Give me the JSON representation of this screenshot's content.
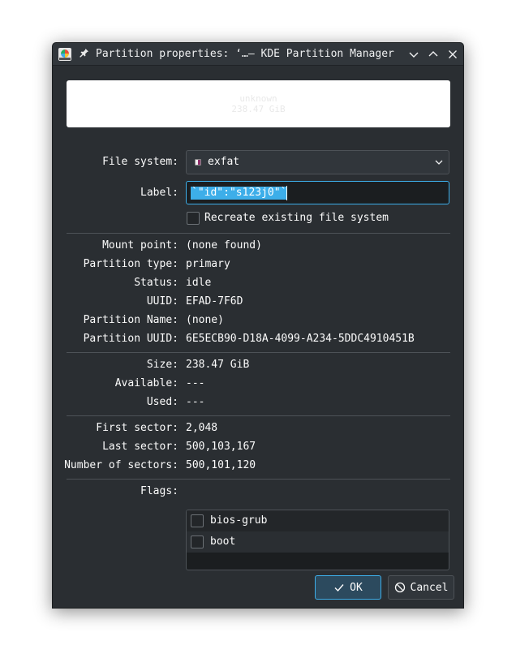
{
  "window": {
    "title": "Partition properties: ‘…— KDE Partition Manager"
  },
  "icons": {
    "app": "kde-partition-manager-icon",
    "pin": "pin-icon",
    "minimize": "chevron-down-icon",
    "maximize": "chevron-up-icon",
    "close": "close-icon",
    "dropdown": "chevron-down-icon",
    "ok": "checkmark-icon",
    "cancel": "cancel-icon"
  },
  "preview": {
    "line1": "unknown",
    "line2": "238.47 GiB"
  },
  "form": {
    "file_system_label": "File system:",
    "file_system_value": "exfat",
    "label_label": "Label:",
    "label_value": "`\"id\":\"s123j0\"`",
    "recreate_label": "Recreate existing file system",
    "recreate_checked": false
  },
  "info": {
    "mount_point_label": "Mount point:",
    "mount_point_value": "(none found)",
    "partition_type_label": "Partition type:",
    "partition_type_value": "primary",
    "status_label": "Status:",
    "status_value": "idle",
    "uuid_label": "UUID:",
    "uuid_value": "EFAD-7F6D",
    "partition_name_label": "Partition Name:",
    "partition_name_value": "(none)",
    "partition_uuid_label": "Partition UUID:",
    "partition_uuid_value": "6E5ECB90-D18A-4099-A234-5DDC4910451B"
  },
  "size": {
    "size_label": "Size:",
    "size_value": "238.47 GiB",
    "available_label": "Available:",
    "available_value": "---",
    "used_label": "Used:",
    "used_value": "---"
  },
  "sectors": {
    "first_label": "First sector:",
    "first_value": "2,048",
    "last_label": "Last sector:",
    "last_value": "500,103,167",
    "count_label": "Number of sectors:",
    "count_value": "500,101,120"
  },
  "flags": {
    "label": "Flags:",
    "items": [
      {
        "label": "bios-grub",
        "checked": false
      },
      {
        "label": "boot",
        "checked": false
      }
    ]
  },
  "buttons": {
    "ok": "OK",
    "cancel": "Cancel"
  },
  "colors": {
    "accent": "#3daee9",
    "background": "#2a2e32",
    "text": "#fcfcfc"
  }
}
